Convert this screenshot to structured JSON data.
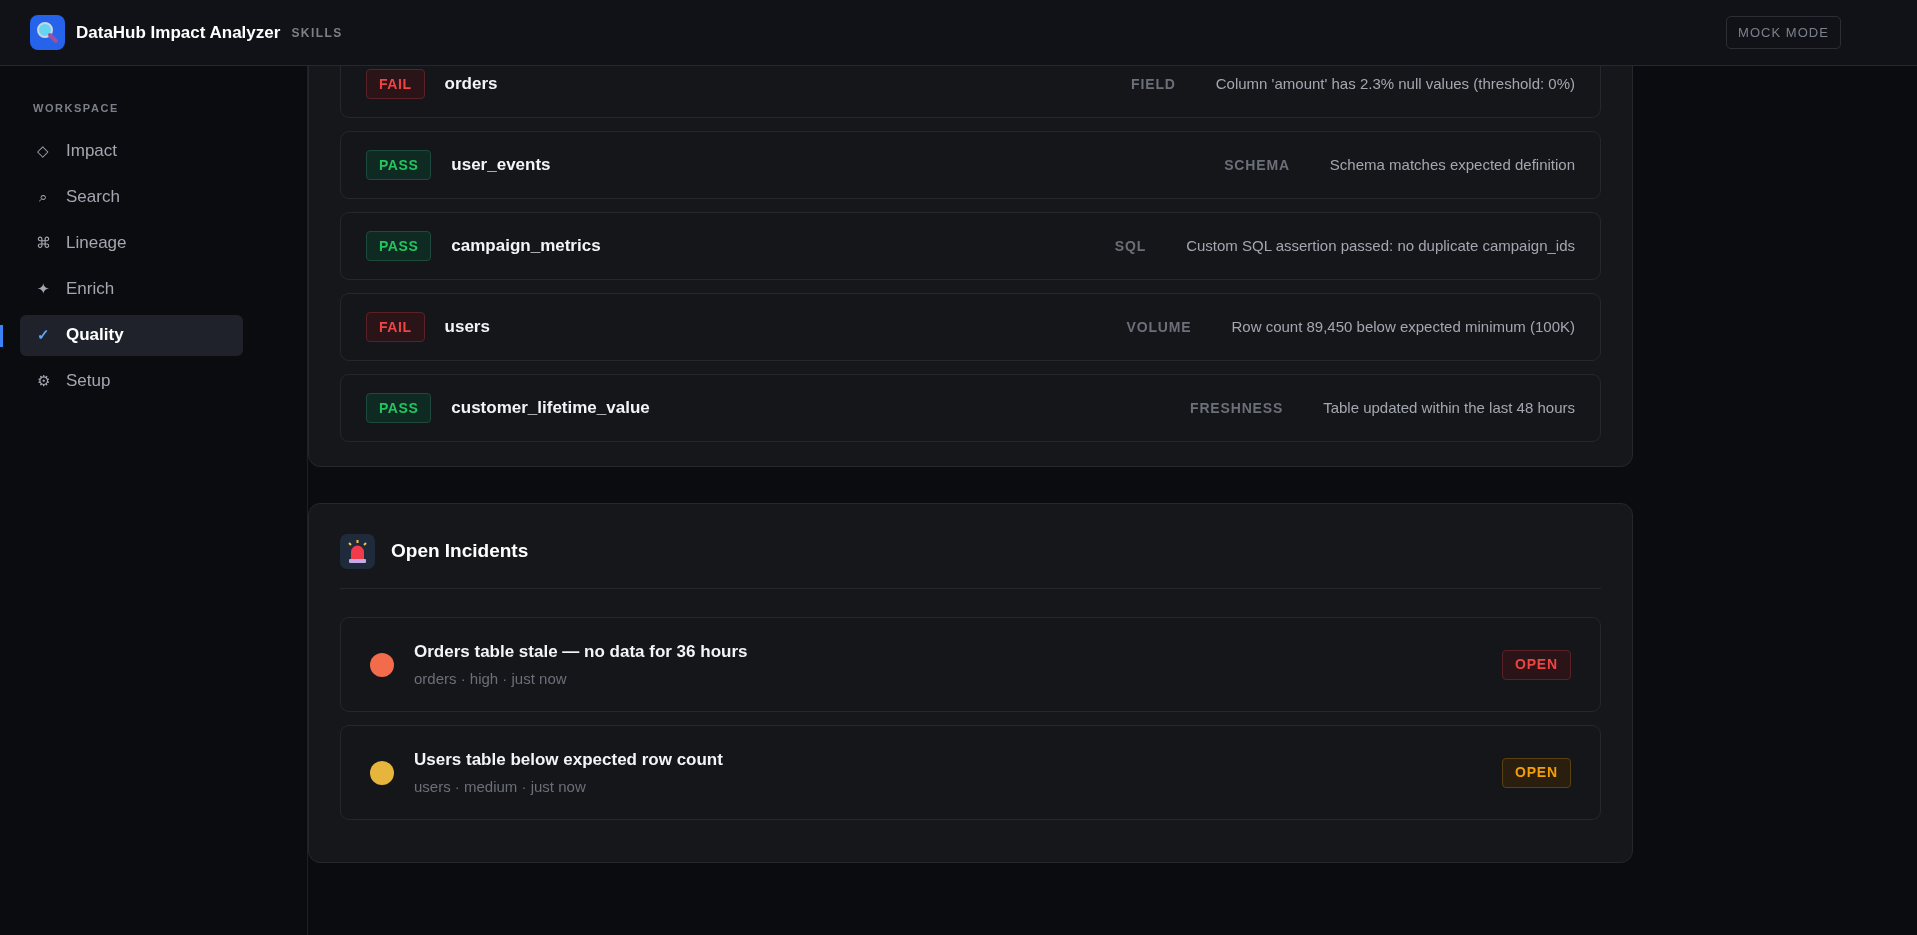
{
  "header": {
    "title": "DataHub Impact Analyzer",
    "tag": "SKILLS",
    "mode_button": "MOCK MODE"
  },
  "sidebar": {
    "section": "WORKSPACE",
    "items": [
      {
        "icon": "◇",
        "label": "Impact",
        "selected": false
      },
      {
        "icon": "⌕",
        "label": "Search",
        "selected": false
      },
      {
        "icon": "⌘",
        "label": "Lineage",
        "selected": false
      },
      {
        "icon": "✦",
        "label": "Enrich",
        "selected": false
      },
      {
        "icon": "✓",
        "label": "Quality",
        "selected": true
      },
      {
        "icon": "⚙",
        "label": "Setup",
        "selected": false
      }
    ]
  },
  "checks": [
    {
      "kind": "fail",
      "status": "FAIL",
      "table": "orders",
      "type": "FIELD",
      "message": "Column 'amount' has 2.3% null values (threshold: 0%)"
    },
    {
      "kind": "pass",
      "status": "PASS",
      "table": "user_events",
      "type": "SCHEMA",
      "message": "Schema matches expected definition"
    },
    {
      "kind": "pass",
      "status": "PASS",
      "table": "campaign_metrics",
      "type": "SQL",
      "message": "Custom SQL assertion passed: no duplicate campaign_ids"
    },
    {
      "kind": "fail",
      "status": "FAIL",
      "table": "users",
      "type": "VOLUME",
      "message": "Row count 89,450 below expected minimum (100K)"
    },
    {
      "kind": "pass",
      "status": "PASS",
      "table": "customer_lifetime_value",
      "type": "FRESHNESS",
      "message": "Table updated within the last 48 hours"
    }
  ],
  "incidents": {
    "title": "Open Incidents",
    "items": [
      {
        "color": "#f26b4a",
        "title": "Orders table stale — no data for 36 hours",
        "meta": "orders · high · just now",
        "status": {
          "label": "OPEN",
          "kind": "danger"
        }
      },
      {
        "color": "#e8b53c",
        "title": "Users table below expected row count",
        "meta": "users · medium · just now",
        "status": {
          "label": "OPEN",
          "kind": "warning"
        }
      }
    ]
  }
}
